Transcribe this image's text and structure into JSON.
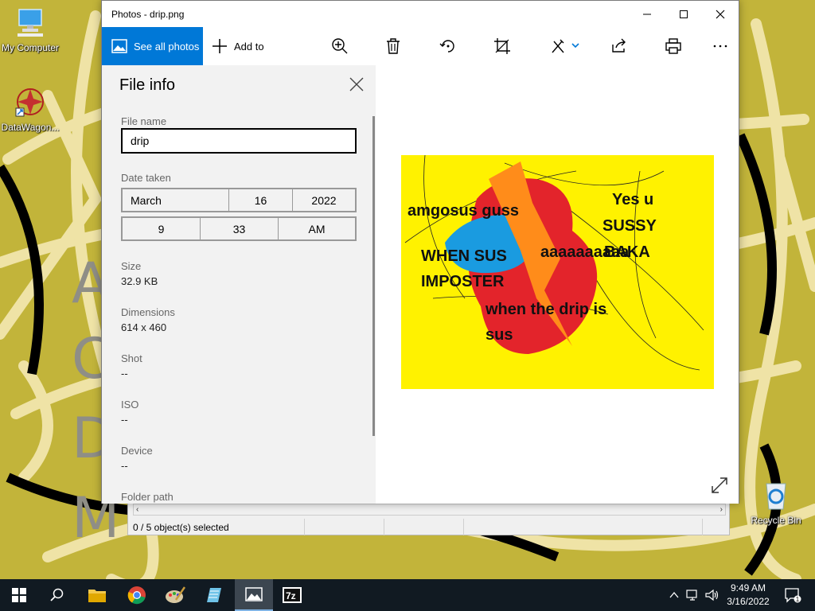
{
  "desktop": {
    "icons": [
      {
        "label": "My Computer"
      },
      {
        "label": "DataWagon..."
      },
      {
        "label": "Recycle Bin"
      }
    ]
  },
  "background_window": {
    "status_text": "0 / 5 object(s) selected"
  },
  "photos": {
    "title": "Photos - drip.png",
    "toolbar": {
      "see_all_label": "See all photos",
      "add_to_label": "Add to"
    },
    "file_info": {
      "title": "File info",
      "file_name_label": "File name",
      "file_name_value": "drip",
      "date_taken_label": "Date taken",
      "month": "March",
      "day": "16",
      "year": "2022",
      "hour": "9",
      "minute": "33",
      "ampm": "AM",
      "size_label": "Size",
      "size_value": "32.9 KB",
      "dimensions_label": "Dimensions",
      "dimensions_value": "614 x 460",
      "shot_label": "Shot",
      "shot_value": "--",
      "iso_label": "ISO",
      "iso_value": "--",
      "device_label": "Device",
      "device_value": "--",
      "folder_label": "Folder path"
    },
    "image_text": {
      "t1": "amgosus guss",
      "t2": "Yes u",
      "t3": "SUSSY",
      "t4": "BAKA",
      "t5": "WHEN SUS",
      "t6": "IMPOSTER",
      "t7": "aaaaaaaaaa",
      "t8": "when the drip is",
      "t9": "sus"
    }
  },
  "taskbar": {
    "time": "9:49 AM",
    "date": "3/16/2022",
    "notification_count": "1",
    "accent": "#7fb2e3"
  }
}
